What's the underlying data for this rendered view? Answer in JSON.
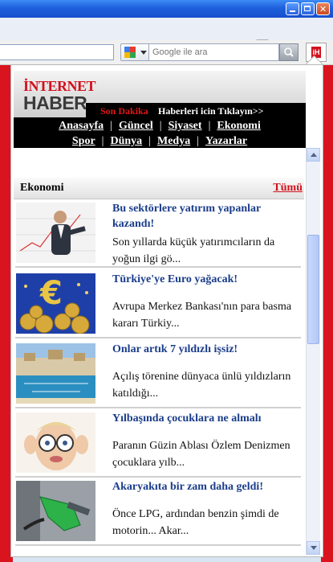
{
  "browser": {
    "window_controls": [
      "minimize-icon",
      "maximize-icon",
      "close-icon"
    ],
    "search": {
      "placeholder": "Google ile ara",
      "engine_icon": "google-icon",
      "go_icon": "magnifier-icon"
    },
    "extension_button": {
      "label": "iH",
      "icon": "internethaber-icon"
    },
    "recycle_icon": "recycle-bin-icon"
  },
  "site": {
    "logo_top": "İNTERNET",
    "logo_bottom": "HABER",
    "breaking_label": "Son Dakika",
    "breaking_text": "Haberleri icin Tıklayın>>",
    "nav_row1": [
      "Anasayfa",
      "Güncel",
      "Siyaset",
      "Ekonomi"
    ],
    "nav_row2": [
      "Spor",
      "Dünya",
      "Medya",
      "Yazarlar"
    ],
    "separator": "|"
  },
  "section": {
    "title": "Ekonomi",
    "all_link": "Tümü"
  },
  "articles": [
    {
      "title": "Bu sektörlere yatırım yapanlar kazandı!",
      "desc": "Son yıllarda küçük yatırımcıların da yoğun ilgi gö...",
      "thumb": "businessman-chart-image"
    },
    {
      "title": "Türkiye'ye Euro yağacak!",
      "desc": "Avrupa Merkez Bankası'nın para basma kararı Türkiy...",
      "thumb": "euro-coins-image"
    },
    {
      "title": "Onlar artık 7 yıldızlı işsiz!",
      "desc": "Açılış törenine dünyaca ünlü yıldızların katıldığı...",
      "thumb": "luxury-hotel-image"
    },
    {
      "title": "Yılbaşında çocuklara ne almalı",
      "desc": "Paranın Güzin Ablası Özlem Denizmen çocuklara yılb...",
      "thumb": "child-glasses-image"
    },
    {
      "title": "Akaryakıta bir zam daha geldi!",
      "desc": "Önce LPG, ardından benzin şimdi de motorin... Akar...",
      "thumb": "fuel-nozzle-image"
    }
  ],
  "colors": {
    "brand_red": "#d2101c",
    "title_blue": "#1a3d8a",
    "xp_blue": "#1e5fdc"
  }
}
